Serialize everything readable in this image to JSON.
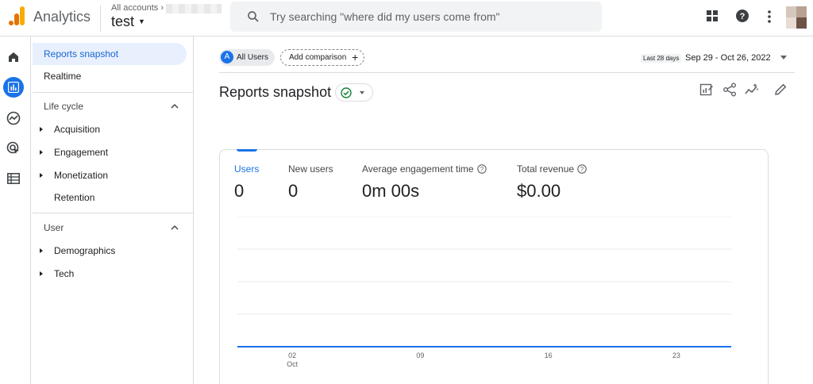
{
  "topbar": {
    "app_name": "Analytics",
    "all_accounts_label": "All accounts",
    "account_name": "test",
    "search_placeholder": "Try searching \"where did my users come from\"",
    "icons": [
      "analytics-logo-icon",
      "search-icon",
      "apps-grid-icon",
      "help-icon",
      "more-vert-icon"
    ]
  },
  "rail": {
    "items": [
      {
        "icon": "home-icon",
        "active": false
      },
      {
        "icon": "reports-icon",
        "active": true
      },
      {
        "icon": "explore-icon",
        "active": false
      },
      {
        "icon": "advertising-icon",
        "active": false
      },
      {
        "icon": "configure-icon",
        "active": false
      }
    ]
  },
  "nav": {
    "items": [
      {
        "label": "Reports snapshot",
        "active": true
      },
      {
        "label": "Realtime",
        "active": false
      }
    ],
    "sections": [
      {
        "title": "Life cycle",
        "items": [
          {
            "label": "Acquisition",
            "expandable": true
          },
          {
            "label": "Engagement",
            "expandable": true
          },
          {
            "label": "Monetization",
            "expandable": true
          },
          {
            "label": "Retention",
            "expandable": false
          }
        ]
      },
      {
        "title": "User",
        "items": [
          {
            "label": "Demographics",
            "expandable": true
          },
          {
            "label": "Tech",
            "expandable": true
          }
        ]
      }
    ]
  },
  "header": {
    "segment_badge": "A",
    "segment_label": "All Users",
    "add_comparison_label": "Add comparison",
    "date_preset": "Last 28 days",
    "date_range": "Sep 29 - Oct 26, 2022",
    "page_title": "Reports snapshot",
    "toolbar_icons": [
      "customize-report-icon",
      "share-icon",
      "insights-icon",
      "edit-icon"
    ]
  },
  "card": {
    "metrics": [
      {
        "label": "Users",
        "value": "0",
        "active": true,
        "info": false
      },
      {
        "label": "New users",
        "value": "0",
        "active": false,
        "info": false
      },
      {
        "label": "Average engagement time",
        "value": "0m 00s",
        "active": false,
        "info": true
      },
      {
        "label": "Total revenue",
        "value": "$0.00",
        "active": false,
        "info": true
      }
    ]
  },
  "chart_data": {
    "type": "line",
    "x_tick_labels": [
      "02",
      "09",
      "16",
      "23"
    ],
    "x_sublabel": "Oct",
    "series": [
      {
        "values": [
          0,
          0,
          0,
          0,
          0,
          0,
          0,
          0,
          0,
          0,
          0,
          0,
          0,
          0,
          0,
          0,
          0,
          0,
          0,
          0,
          0,
          0,
          0,
          0,
          0,
          0,
          0,
          0
        ],
        "color": "#1a73e8"
      }
    ],
    "grid": true,
    "colors": {
      "line": "#1a73e8",
      "grid": "#e8eaed"
    }
  }
}
